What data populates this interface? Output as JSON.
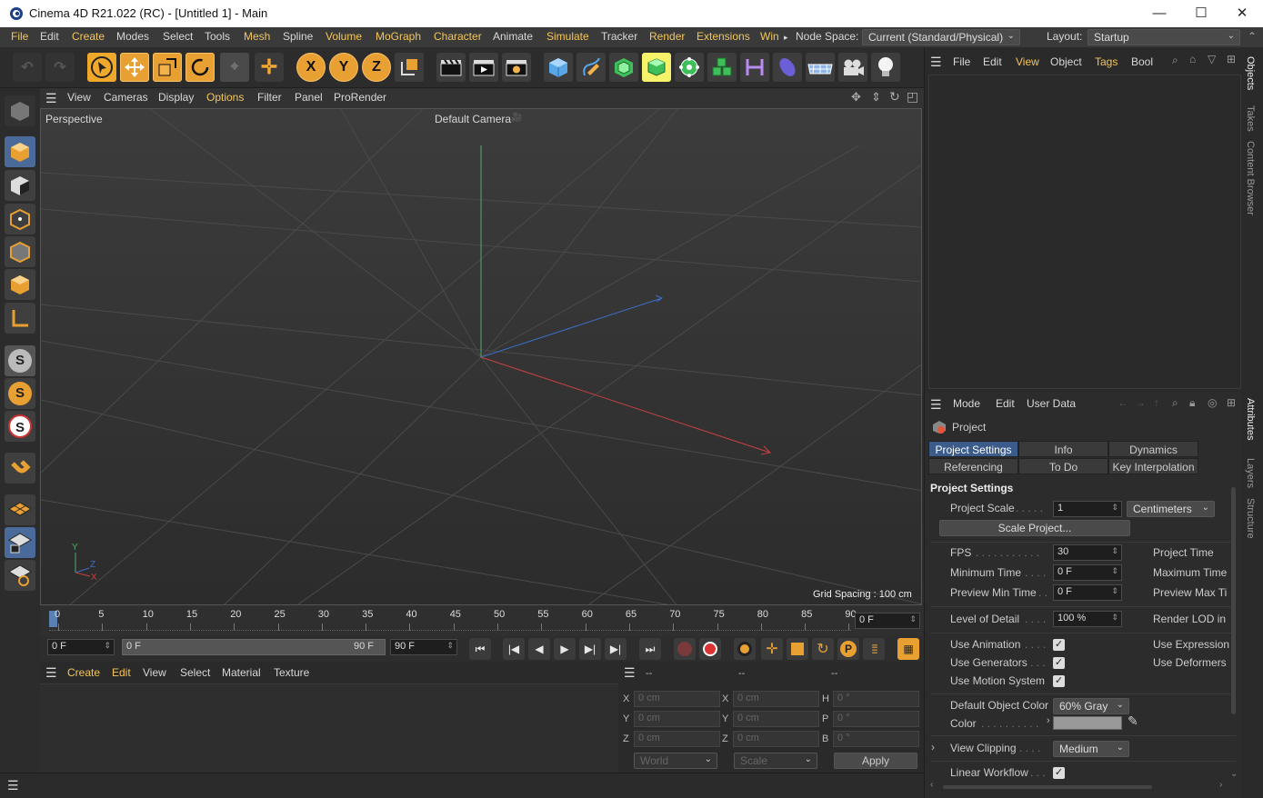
{
  "window": {
    "title": "Cinema 4D R21.022 (RC) - [Untitled 1] - Main",
    "minimize": "—",
    "maximize": "☐",
    "close": "✕"
  },
  "menubar": {
    "items": [
      "File",
      "Edit",
      "Create",
      "Modes",
      "Select",
      "Tools",
      "Mesh",
      "Spline",
      "Volume",
      "MoGraph",
      "Character",
      "Animate",
      "Simulate",
      "Tracker",
      "Render",
      "Extensions",
      "Win"
    ],
    "node_space_label": "Node Space:",
    "node_space_value": "Current (Standard/Physical)",
    "layout_label": "Layout:",
    "layout_value": "Startup"
  },
  "toolbar": {
    "axis_x": "X",
    "axis_y": "Y",
    "axis_z": "Z"
  },
  "left_toolbar": {
    "snap_s": "S"
  },
  "viewport": {
    "menu": [
      "View",
      "Cameras",
      "Display",
      "Options",
      "Filter",
      "Panel",
      "ProRender"
    ],
    "view_name": "Perspective",
    "camera": "Default Camera",
    "grid_spacing": "Grid Spacing : 100 cm",
    "axis_y": "Y",
    "axis_z": "Z",
    "axis_x": "X"
  },
  "timeline": {
    "ticks": [
      "0",
      "5",
      "10",
      "15",
      "20",
      "25",
      "30",
      "35",
      "40",
      "45",
      "50",
      "55",
      "60",
      "65",
      "70",
      "75",
      "80",
      "85",
      "90"
    ],
    "current_frame": "0 F",
    "start": "0 F",
    "range_start": "0 F",
    "range_end": "90 F",
    "end": "90 F"
  },
  "material_manager": {
    "menu": [
      "Create",
      "Edit",
      "View",
      "Select",
      "Material",
      "Texture"
    ]
  },
  "coordinates": {
    "headers": [
      "--",
      "--",
      "--"
    ],
    "rows": [
      {
        "a": "X",
        "av": "0 cm",
        "b": "X",
        "bv": "0 cm",
        "c": "H",
        "cv": "0 °"
      },
      {
        "a": "Y",
        "av": "0 cm",
        "b": "Y",
        "bv": "0 cm",
        "c": "P",
        "cv": "0 °"
      },
      {
        "a": "Z",
        "av": "0 cm",
        "b": "Z",
        "bv": "0 cm",
        "c": "B",
        "cv": "0 °"
      }
    ],
    "mode": "World",
    "size_mode": "Scale",
    "apply": "Apply"
  },
  "object_manager": {
    "menu": [
      "File",
      "Edit",
      "View",
      "Object",
      "Tags",
      "Bool"
    ]
  },
  "attributes": {
    "menu": [
      "Mode",
      "Edit",
      "User Data"
    ],
    "object_name": "Project",
    "tabs_row1": [
      "Project Settings",
      "Info",
      "Dynamics"
    ],
    "tabs_row2": [
      "Referencing",
      "To Do",
      "Key Interpolation"
    ],
    "section": "Project Settings",
    "project_scale_label": "Project Scale",
    "project_scale_value": "1",
    "project_scale_unit": "Centimeters",
    "scale_project_button": "Scale Project...",
    "fps_label": "FPS",
    "fps_value": "30",
    "project_time_label": "Project Time",
    "min_time_label": "Minimum Time",
    "min_time_value": "0 F",
    "max_time_label": "Maximum Time",
    "preview_min_label": "Preview Min Time",
    "preview_min_value": "0 F",
    "preview_max_label": "Preview Max Ti",
    "lod_label": "Level of Detail",
    "lod_value": "100 %",
    "render_lod_label": "Render LOD in",
    "use_animation": "Use Animation",
    "use_expression": "Use Expression",
    "use_generators": "Use Generators",
    "use_deformers": "Use Deformers",
    "use_motion": "Use Motion System",
    "default_color_label": "Default Object Color",
    "default_color_value": "60% Gray",
    "color_label": "Color",
    "view_clipping_label": "View Clipping",
    "view_clipping_value": "Medium",
    "linear_workflow": "Linear Workflow",
    "check": "✓"
  },
  "right_tabs": {
    "objects": "Objects",
    "takes": "Takes",
    "content_browser": "Content Browser",
    "attributes": "Attributes",
    "layers": "Layers",
    "structure": "Structure"
  },
  "colors": {
    "accent": "#f4c65a",
    "selected_tab": "#3b5b8a",
    "axis_x": "#c94040",
    "axis_y": "#4caf6a",
    "axis_z": "#3b6fc9"
  }
}
